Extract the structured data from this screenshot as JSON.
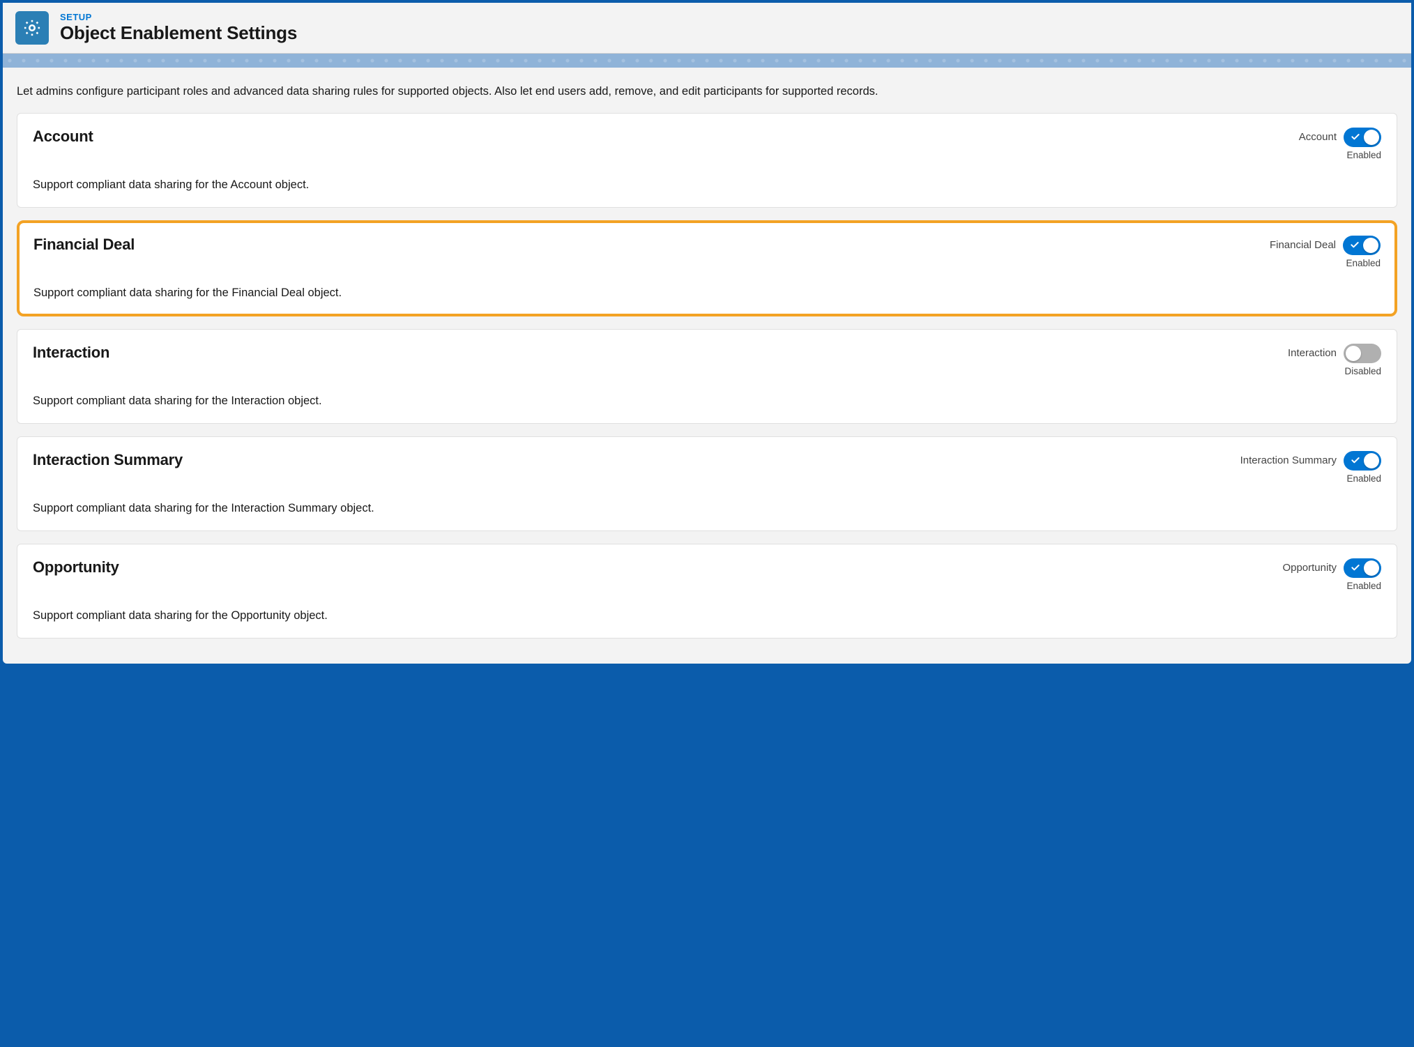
{
  "header": {
    "setup_label": "SETUP",
    "title": "Object Enablement Settings"
  },
  "intro_text": "Let admins configure participant roles and advanced data sharing rules for supported objects. Also let end users add, remove, and edit participants for supported records.",
  "status_labels": {
    "enabled": "Enabled",
    "disabled": "Disabled"
  },
  "cards": [
    {
      "title": "Account",
      "description": "Support compliant data sharing for the Account object.",
      "toggle_label": "Account",
      "enabled": true,
      "highlighted": false
    },
    {
      "title": "Financial Deal",
      "description": "Support compliant data sharing for the Financial Deal object.",
      "toggle_label": "Financial Deal",
      "enabled": true,
      "highlighted": true
    },
    {
      "title": "Interaction",
      "description": "Support compliant data sharing for the Interaction object.",
      "toggle_label": "Interaction",
      "enabled": false,
      "highlighted": false
    },
    {
      "title": "Interaction Summary",
      "description": "Support compliant data sharing for the Interaction Summary object.",
      "toggle_label": "Interaction Summary",
      "enabled": true,
      "highlighted": false
    },
    {
      "title": "Opportunity",
      "description": "Support compliant data sharing for the Opportunity object.",
      "toggle_label": "Opportunity",
      "enabled": true,
      "highlighted": false
    }
  ]
}
